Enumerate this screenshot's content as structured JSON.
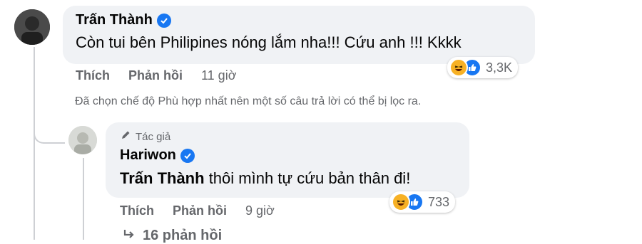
{
  "comment": {
    "author": "Trấn Thành",
    "text": "Còn tui bên Philipines nóng lắm nha!!! Cứu anh !!! Kkkk",
    "actions": {
      "like": "Thích",
      "reply": "Phản hồi",
      "time": "11 giờ"
    },
    "reactions": {
      "icons": [
        "haha-icon",
        "like-icon"
      ],
      "count": "3,3K"
    }
  },
  "filter_note": "Đã chọn chế độ Phù hợp nhất nên một số câu trả lời có thể bị lọc ra.",
  "reply": {
    "role": "Tác giả",
    "author": "Hariwon",
    "mention": "Trấn Thành",
    "text": "thôi mình tự cứu bản thân đi!",
    "actions": {
      "like": "Thích",
      "reply": "Phản hồi",
      "time": "9 giờ"
    },
    "reactions": {
      "icons": [
        "haha-icon",
        "like-icon"
      ],
      "count": "733"
    }
  },
  "more_replies": {
    "label": "16 phản hồi"
  },
  "colors": {
    "verified": "#1877f2",
    "bubble": "#f0f2f5",
    "secondary_text": "#65676b"
  }
}
